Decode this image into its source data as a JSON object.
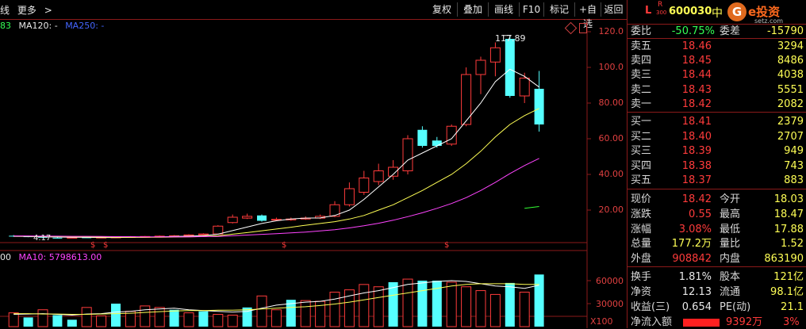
{
  "toolbar": {
    "left_labels": [
      "线",
      "更多",
      ">"
    ],
    "buttons": [
      "复权",
      "叠加",
      "画线",
      "F10",
      "标记",
      "+自选",
      "返回"
    ]
  },
  "ma_legend": {
    "prefix": "83",
    "ma120": "MA120: -",
    "ma250": "MA250: -"
  },
  "vol_legend": {
    "prefix": "00",
    "ma10": "MA10: 5798613.00"
  },
  "price_axis": {
    "labels": [
      "120.0",
      "100.0",
      "80.00",
      "60.00",
      "40.00",
      "20.00"
    ]
  },
  "volume_axis": {
    "labels": [
      "60000",
      "30000"
    ],
    "unit": "X100"
  },
  "annotations": {
    "high_label": "117.89",
    "low_label": "4.17",
    "marker": "$"
  },
  "quote": {
    "l_mark": "L",
    "r_mark": "R",
    "r_sub": "300",
    "code": "600030",
    "name": "中",
    "brand": "e投资",
    "brand_url": "setz.com",
    "weibi_label": "委比",
    "weibi_value": "-50.75%",
    "weicha_label": "委差",
    "weicha_value": "-15790",
    "asks": [
      {
        "label": "卖五",
        "price": "18.46",
        "vol": "3294"
      },
      {
        "label": "卖四",
        "price": "18.45",
        "vol": "8486"
      },
      {
        "label": "卖三",
        "price": "18.44",
        "vol": "4038"
      },
      {
        "label": "卖二",
        "price": "18.43",
        "vol": "5551"
      },
      {
        "label": "卖一",
        "price": "18.42",
        "vol": "2082"
      }
    ],
    "bids": [
      {
        "label": "买一",
        "price": "18.41",
        "vol": "2379"
      },
      {
        "label": "买二",
        "price": "18.40",
        "vol": "2707"
      },
      {
        "label": "买三",
        "price": "18.39",
        "vol": "949"
      },
      {
        "label": "买四",
        "price": "18.38",
        "vol": "743"
      },
      {
        "label": "买五",
        "price": "18.37",
        "vol": "883"
      }
    ],
    "stats": [
      {
        "l1": "现价",
        "v1": "18.42",
        "l2": "今开",
        "v2": "18.03"
      },
      {
        "l1": "涨跌",
        "v1": "0.55",
        "l2": "最高",
        "v2": "18.47"
      },
      {
        "l1": "涨幅",
        "v1": "3.08%",
        "l2": "最低",
        "v2": "17.88"
      },
      {
        "l1": "总量",
        "v1": "177.2万",
        "l2": "量比",
        "v2": "1.52"
      },
      {
        "l1": "外盘",
        "v1": "908842",
        "l2": "内盘",
        "v2": "863190"
      }
    ],
    "stats2": [
      {
        "l1": "换手",
        "v1": "1.81%",
        "l2": "股本",
        "v2": "121亿"
      },
      {
        "l1": "净资",
        "v1": "12.13",
        "l2": "流通",
        "v2": "98.1亿"
      },
      {
        "l1": "收益(三)",
        "v1": "0.654",
        "l2": "PE(动)",
        "v2": "21.1"
      }
    ],
    "netflow_label": "净流入额",
    "netflow_value": "9392万",
    "netflow_pct": "3%"
  },
  "colors": {
    "up": "#ff3b3b",
    "down": "#55ffff",
    "ma5": "#ffffff",
    "ma10": "#ffff55",
    "ma20": "#ff44ff",
    "ma60": "#33ff33",
    "axis": "#8b1a1a"
  },
  "chart_data": [
    {
      "type": "candlestick",
      "title": "",
      "ylim": [
        0,
        125
      ],
      "yticks": [
        20,
        40,
        60,
        80,
        100,
        120
      ],
      "candles": [
        {
          "o": 5.6,
          "c": 5.4,
          "h": 6.0,
          "l": 5.0
        },
        {
          "o": 5.3,
          "c": 5.0,
          "h": 5.6,
          "l": 4.8
        },
        {
          "o": 5.0,
          "c": 4.5,
          "h": 5.2,
          "l": 4.2
        },
        {
          "o": 4.5,
          "c": 4.3,
          "h": 4.9,
          "l": 4.17
        },
        {
          "o": 4.4,
          "c": 4.7,
          "h": 5.0,
          "l": 4.3
        },
        {
          "o": 4.7,
          "c": 4.6,
          "h": 5.1,
          "l": 4.4
        },
        {
          "o": 4.6,
          "c": 4.8,
          "h": 5.2,
          "l": 4.4
        },
        {
          "o": 4.8,
          "c": 4.9,
          "h": 5.2,
          "l": 4.6
        },
        {
          "o": 4.9,
          "c": 5.1,
          "h": 5.4,
          "l": 4.7
        },
        {
          "o": 5.1,
          "c": 5.2,
          "h": 5.5,
          "l": 4.9
        },
        {
          "o": 5.2,
          "c": 5.4,
          "h": 5.8,
          "l": 5.0
        },
        {
          "o": 5.4,
          "c": 5.6,
          "h": 6.0,
          "l": 5.2
        },
        {
          "o": 5.6,
          "c": 6.1,
          "h": 6.5,
          "l": 5.4
        },
        {
          "o": 6.1,
          "c": 6.6,
          "h": 7.0,
          "l": 5.9
        },
        {
          "o": 6.6,
          "c": 11.0,
          "h": 11.5,
          "l": 6.4
        },
        {
          "o": 13.0,
          "c": 16.0,
          "h": 17.5,
          "l": 12.5
        },
        {
          "o": 15.5,
          "c": 16.5,
          "h": 18.0,
          "l": 15.0
        },
        {
          "o": 17.0,
          "c": 14.0,
          "h": 17.5,
          "l": 13.5
        },
        {
          "o": 14.5,
          "c": 14.8,
          "h": 15.8,
          "l": 14.0
        },
        {
          "o": 14.5,
          "c": 15.0,
          "h": 15.8,
          "l": 14.0
        },
        {
          "o": 15.0,
          "c": 15.5,
          "h": 16.5,
          "l": 14.5
        },
        {
          "o": 15.5,
          "c": 16.5,
          "h": 17.5,
          "l": 15.0
        },
        {
          "o": 16.5,
          "c": 23.0,
          "h": 25.0,
          "l": 16.0
        },
        {
          "o": 23.0,
          "c": 32.0,
          "h": 35.5,
          "l": 22.0
        },
        {
          "o": 30.0,
          "c": 38.0,
          "h": 42.0,
          "l": 28.5
        },
        {
          "o": 36.0,
          "c": 42.0,
          "h": 46.0,
          "l": 34.0
        },
        {
          "o": 39.0,
          "c": 44.0,
          "h": 48.0,
          "l": 37.0
        },
        {
          "o": 42.0,
          "c": 60.0,
          "h": 62.0,
          "l": 40.0
        },
        {
          "o": 65.0,
          "c": 56.0,
          "h": 67.0,
          "l": 55.0
        },
        {
          "o": 59.0,
          "c": 56.0,
          "h": 61.0,
          "l": 55.0
        },
        {
          "o": 57.0,
          "c": 67.0,
          "h": 68.0,
          "l": 56.0
        },
        {
          "o": 68.0,
          "c": 96.0,
          "h": 100.0,
          "l": 67.0
        },
        {
          "o": 96.0,
          "c": 104.0,
          "h": 106.0,
          "l": 85.0
        },
        {
          "o": 103.0,
          "c": 111.0,
          "h": 114.0,
          "l": 95.0
        },
        {
          "o": 116.0,
          "c": 84.0,
          "h": 117.89,
          "l": 83.0
        },
        {
          "o": 84.0,
          "c": 94.0,
          "h": 97.0,
          "l": 80.0
        },
        {
          "o": 88.0,
          "c": 68.0,
          "h": 98.0,
          "l": 64.0
        }
      ],
      "ma5": [
        5.3,
        5.2,
        5.0,
        4.9,
        4.8,
        4.7,
        4.6,
        4.6,
        4.7,
        4.8,
        5.0,
        5.2,
        5.4,
        5.7,
        6.5,
        8.5,
        10.5,
        12.5,
        14.0,
        15.0,
        15.5,
        15.6,
        17.0,
        20.0,
        26.0,
        33.0,
        40.0,
        48.0,
        52.0,
        56.0,
        60.0,
        70.0,
        80.0,
        92.0,
        99.0,
        95.0,
        89.0
      ],
      "ma10": [
        5.5,
        5.4,
        5.3,
        5.2,
        5.1,
        5.0,
        4.9,
        4.8,
        4.8,
        4.8,
        4.8,
        4.9,
        5.0,
        5.2,
        5.6,
        6.5,
        7.4,
        8.4,
        9.4,
        10.4,
        11.5,
        12.5,
        13.5,
        15.0,
        17.0,
        20.0,
        23.0,
        27.0,
        31.0,
        35.5,
        40.0,
        46.0,
        53.0,
        61.0,
        68.0,
        73.0,
        77.0
      ],
      "ma20": [
        5.5,
        5.5,
        5.4,
        5.4,
        5.3,
        5.3,
        5.2,
        5.1,
        5.1,
        5.0,
        5.0,
        5.0,
        5.0,
        5.1,
        5.2,
        5.6,
        6.0,
        6.4,
        6.8,
        7.2,
        7.7,
        8.3,
        9.0,
        10.0,
        11.2,
        12.6,
        14.3,
        16.3,
        18.5,
        21.0,
        23.7,
        27.0,
        31.0,
        35.5,
        40.5,
        45.0,
        49.0
      ],
      "ma60_tail": [
        21.0,
        22.0
      ]
    },
    {
      "type": "bar",
      "title": "",
      "ylim": [
        0,
        85000
      ],
      "yticks": [
        30000,
        60000
      ],
      "values": [
        18000,
        12000,
        22000,
        15000,
        9000,
        25000,
        14000,
        30000,
        20000,
        27000,
        25000,
        22000,
        18000,
        20000,
        16000,
        15000,
        25000,
        40000,
        22000,
        35000,
        34000,
        33000,
        45000,
        48000,
        55000,
        52000,
        58000,
        62000,
        60000,
        60000,
        58000,
        52000,
        47000,
        42000,
        57000,
        45000,
        68000
      ],
      "down": [
        false,
        true,
        false,
        true,
        true,
        false,
        false,
        true,
        false,
        false,
        false,
        true,
        false,
        true,
        false,
        false,
        true,
        false,
        false,
        true,
        false,
        false,
        false,
        false,
        false,
        false,
        true,
        false,
        true,
        true,
        false,
        false,
        false,
        false,
        true,
        false,
        true
      ],
      "ma5": [
        16000,
        16500,
        17000,
        16000,
        15000,
        16500,
        17000,
        19000,
        20000,
        22000,
        23000,
        24000,
        22000,
        21000,
        20000,
        19000,
        20000,
        24000,
        28000,
        30000,
        32000,
        33000,
        36000,
        40000,
        44000,
        47000,
        51000,
        55000,
        57000,
        59000,
        60000,
        59000,
        56000,
        53000,
        52000,
        50000,
        54000
      ],
      "ma10": [
        17000,
        17000,
        16500,
        16500,
        16000,
        16000,
        16500,
        17000,
        17500,
        18500,
        19500,
        20500,
        21000,
        21000,
        21500,
        21500,
        22000,
        23000,
        24000,
        25000,
        26000,
        27500,
        29500,
        32000,
        35000,
        38000,
        41000,
        44000,
        47000,
        50000,
        53000,
        55000,
        56000,
        56000,
        56000,
        55000,
        55000
      ]
    }
  ]
}
